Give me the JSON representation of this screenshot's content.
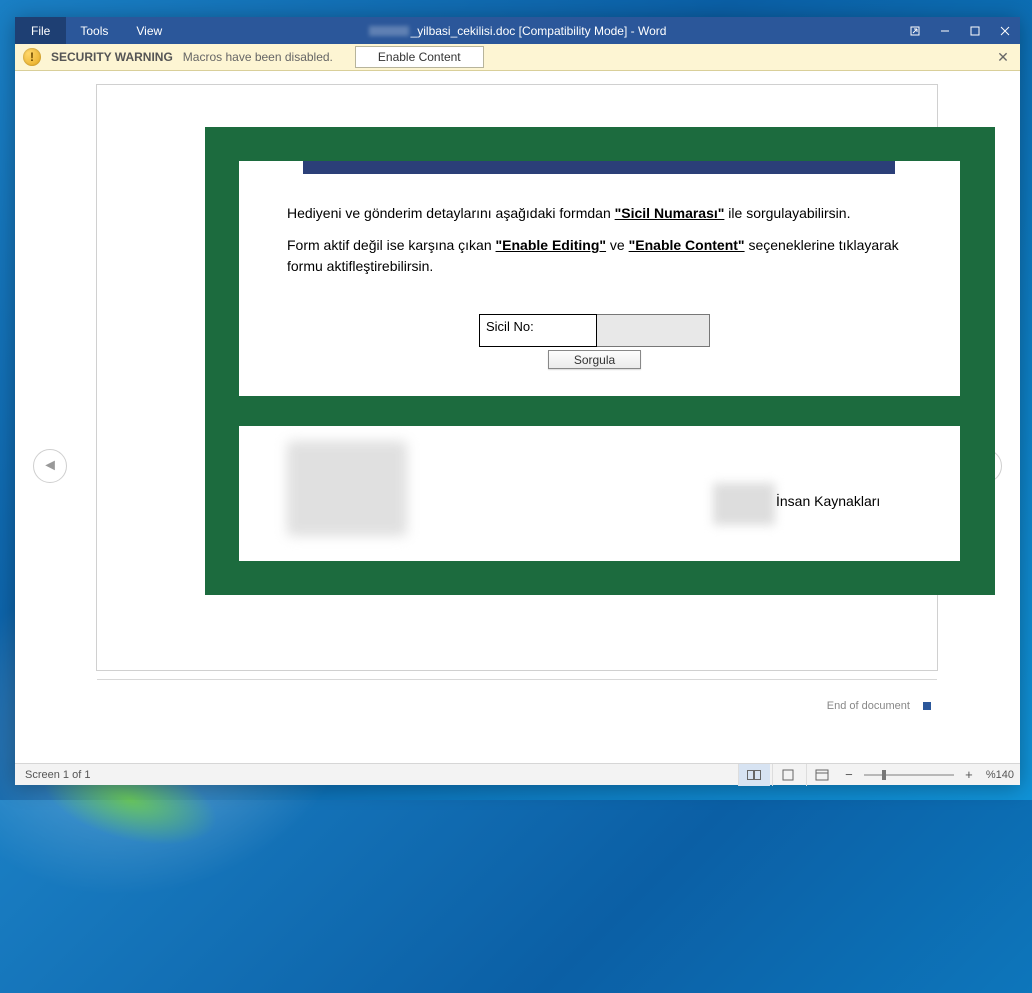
{
  "titlebar": {
    "menu": {
      "file": "File",
      "tools": "Tools",
      "view": "View"
    },
    "doc_title": "_yilbasi_cekilisi.doc [Compatibility Mode] - Word"
  },
  "security": {
    "title": "SECURITY WARNING",
    "message": "Macros have been disabled.",
    "enable_label": "Enable Content"
  },
  "document": {
    "p1_pre": "Hediyeni ve gönderim detaylarını aşağıdaki formdan ",
    "p1_bold": "\"Sicil Numarası\"",
    "p1_post": " ile sorgulayabilirsin.",
    "p2_pre": "Form aktif değil ise karşına çıkan ",
    "p2_b1": "\"Enable Editing\"",
    "p2_mid": " ve ",
    "p2_b2": "\"Enable Content\"",
    "p2_post": " seçeneklerine tıklayarak formu aktifleştirebilirsin.",
    "sicil_label": "Sicil No:",
    "sorgula_label": "Sorgula",
    "ik_label": "İnsan Kaynakları",
    "end_label": "End of document"
  },
  "status": {
    "screen": "Screen 1 of 1",
    "zoom": "%140"
  }
}
